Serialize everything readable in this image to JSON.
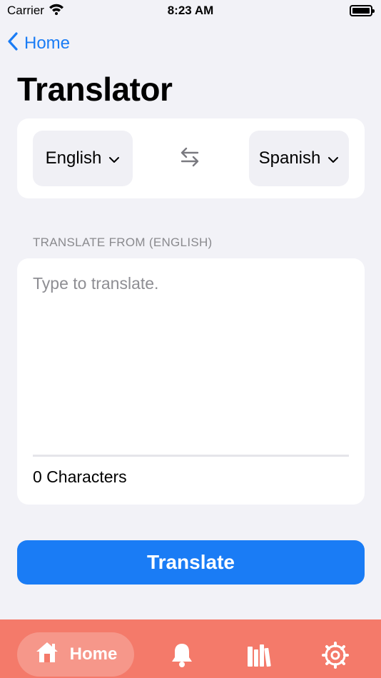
{
  "status_bar": {
    "carrier": "Carrier",
    "time": "8:23 AM"
  },
  "nav": {
    "back_label": "Home"
  },
  "page": {
    "title": "Translator"
  },
  "languages": {
    "from": "English",
    "to": "Spanish"
  },
  "input": {
    "section_label": "TRANSLATE FROM (ENGLISH)",
    "placeholder": "Type to translate.",
    "value": "",
    "char_count": "0 Characters"
  },
  "actions": {
    "translate_label": "Translate"
  },
  "tab_bar": {
    "active_label": "Home",
    "items": [
      "home-icon",
      "bell-icon",
      "books-icon",
      "settings-icon"
    ]
  },
  "colors": {
    "accent": "#1a7cf5",
    "tab_bar": "#f47a6a",
    "background": "#f2f2f7"
  }
}
